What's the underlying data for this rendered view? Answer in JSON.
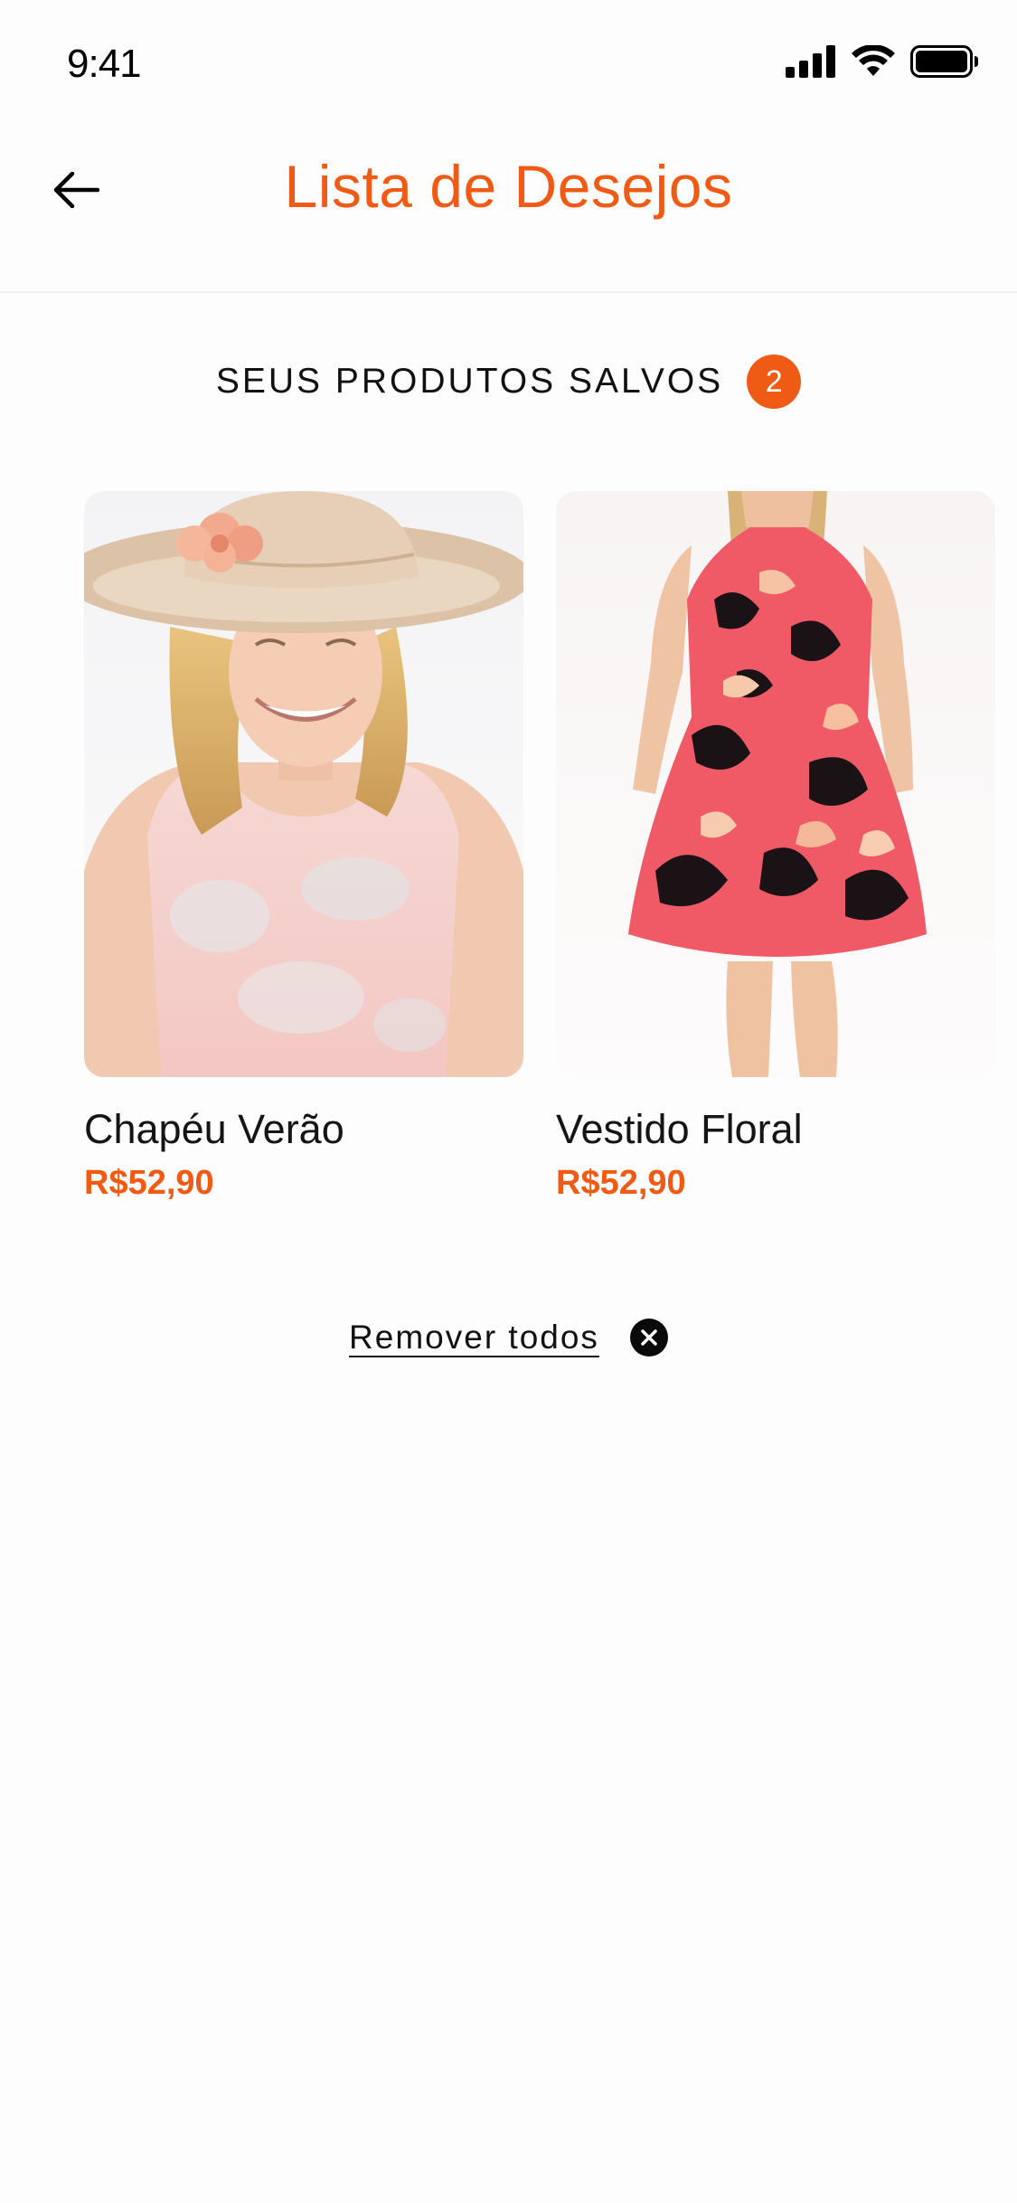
{
  "status_bar": {
    "time": "9:41",
    "icons": [
      "signal-icon",
      "wifi-icon",
      "battery-icon"
    ]
  },
  "header": {
    "back_icon": "arrow-left-icon",
    "title": "Lista de Desejos"
  },
  "section": {
    "title": "SEUS PRODUTOS SALVOS",
    "count": "2"
  },
  "products": [
    {
      "name": "Chapéu Verão",
      "price": "R$52,90",
      "image_icon": "hat-model-image"
    },
    {
      "name": "Vestido Floral",
      "price": "R$52,90",
      "image_icon": "floral-dress-image"
    }
  ],
  "actions": {
    "remove_all_label": "Remover todos",
    "remove_all_icon": "close-circle-icon"
  },
  "colors": {
    "accent": "#ef5a14",
    "text": "#111111",
    "background": "#ffffff"
  }
}
